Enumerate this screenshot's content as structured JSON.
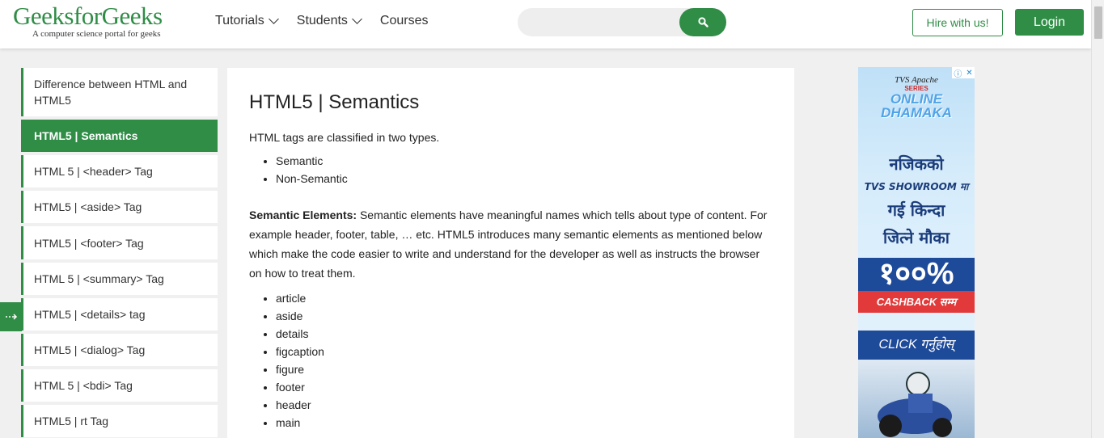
{
  "header": {
    "logo_title": "GeeksforGeeks",
    "logo_tagline": "A computer science portal for geeks",
    "nav": [
      "Tutorials",
      "Students",
      "Courses"
    ],
    "search_placeholder": "",
    "hire_label": "Hire with us!",
    "login_label": "Login"
  },
  "sidebar": {
    "items": [
      {
        "label": "Difference between HTML and HTML5"
      },
      {
        "label": "HTML5 | Semantics"
      },
      {
        "label": "HTML 5 | <header> Tag"
      },
      {
        "label": "HTML5 | <aside> Tag"
      },
      {
        "label": "HTML5 | <footer> Tag"
      },
      {
        "label": "HTML 5 | <summary> Tag"
      },
      {
        "label": "HTML5 | <details> tag"
      },
      {
        "label": "HTML5 | <dialog> Tag"
      },
      {
        "label": "HTML 5 | <bdi> Tag"
      },
      {
        "label": "HTML5 | rt Tag"
      }
    ],
    "toggle_icon": "arrow-right-icon"
  },
  "article": {
    "title": "HTML5 | Semantics",
    "intro": "HTML tags are classified in two types.",
    "types": [
      "Semantic",
      "Non-Semantic"
    ],
    "semantic_heading": "Semantic Elements:",
    "semantic_text": "Semantic elements have meaningful names which tells about type of content. For example header, footer, table, … etc. HTML5 introduces many semantic elements as mentioned below which make the code easier to write and understand for the developer as well as instructs the browser on how to treat them.",
    "elements": [
      "article",
      "aside",
      "details",
      "figcaption",
      "figure",
      "footer",
      "header",
      "main"
    ]
  },
  "ad": {
    "brand": "TVS Apache",
    "series": "SERIES",
    "line1": "ONLINE",
    "line2": "DHAMAKA",
    "dev1": "नजिकको",
    "dev2": "TVS SHOWROOM मा",
    "dev3": "गई किन्दा",
    "dev4": "जित्ने मौका",
    "percent": "१००%",
    "cashback": "CASHBACK सम्म",
    "click": "CLICK गर्नुहोस्"
  },
  "colors": {
    "brand_green": "#2f8d46",
    "background": "#f0f0f0"
  }
}
